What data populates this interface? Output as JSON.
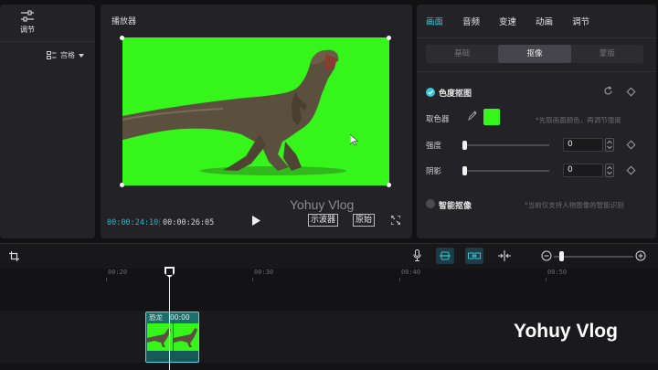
{
  "left_panel": {
    "adjust_label": "调节",
    "grid_label": "宫格"
  },
  "player": {
    "title": "播放器",
    "watermark": "Yohuy Vlog",
    "time_current": "00:00:24:10",
    "time_separator": "|",
    "time_total": "00:00:26:05",
    "waveform_label": "示波器",
    "original_label": "原始"
  },
  "inspector": {
    "tabs": [
      "画面",
      "音频",
      "变速",
      "动画",
      "调节"
    ],
    "active_tab": "画面",
    "subtabs": [
      "基础",
      "抠像",
      "蒙版"
    ],
    "active_subtab": "抠像",
    "chroma_key_label": "色度抠图",
    "color_picker_label": "取色器",
    "picker_hint": "*先取画面颜色，再调节强度",
    "picked_color": "#35f51b",
    "intensity_label": "强度",
    "intensity_value": "0",
    "shadow_label": "阴影",
    "shadow_value": "0",
    "smart_key_label": "智能抠像",
    "smart_key_hint": "*当前仅支持人物图像的智能识别"
  },
  "timeline": {
    "ruler_ticks": [
      "00:20",
      "00:30",
      "00:40",
      "00:50"
    ],
    "clip_name": "恐龙",
    "clip_time": "00:00",
    "watermark": "Yohuy Vlog"
  },
  "colors": {
    "accent": "#35c6d8",
    "chroma_green": "#35f51b"
  }
}
